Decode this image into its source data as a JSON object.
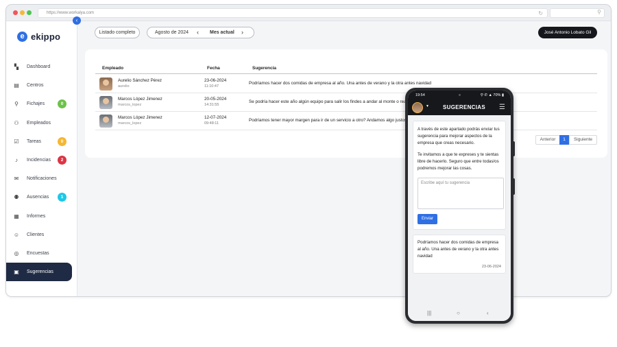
{
  "browser": {
    "url": "https://www.workalya.com"
  },
  "logo": {
    "text": "ekippo"
  },
  "sidebar": {
    "items": [
      {
        "label": "Dashboard",
        "icon": "dashboard-icon",
        "glyph": "▚"
      },
      {
        "label": "Centros",
        "icon": "building-icon",
        "glyph": "▤"
      },
      {
        "label": "Fichajes",
        "icon": "location-pin-icon",
        "glyph": "⚲",
        "badge": "0",
        "badge_color": "#6cc24a"
      },
      {
        "label": "Empleados",
        "icon": "users-icon",
        "glyph": "⚇"
      },
      {
        "label": "Tareas",
        "icon": "calendar-check-icon",
        "glyph": "☑",
        "badge": "0",
        "badge_color": "#f5b731"
      },
      {
        "label": "Incidencias",
        "icon": "bell-icon",
        "glyph": "♪",
        "badge": "2",
        "badge_color": "#dc3545"
      },
      {
        "label": "Notificaciones",
        "icon": "chat-icon",
        "glyph": "✉"
      },
      {
        "label": "Ausencias",
        "icon": "user-minus-icon",
        "glyph": "⚉",
        "badge": "1",
        "badge_color": "#1ec8e6"
      },
      {
        "label": "Informes",
        "icon": "document-icon",
        "glyph": "▦"
      },
      {
        "label": "Clientes",
        "icon": "user-icon",
        "glyph": "☺"
      },
      {
        "label": "Encuestas",
        "icon": "survey-icon",
        "glyph": "◎"
      },
      {
        "label": "Sugerencias",
        "icon": "inbox-icon",
        "glyph": "▣",
        "active": true
      }
    ]
  },
  "toolbar": {
    "listado": "Listado completo",
    "month": "Agosto de 2024",
    "current": "Mes actual",
    "user": "José Antonio Lobato Gil"
  },
  "table": {
    "headers": {
      "employee": "Empleado",
      "date": "Fecha",
      "suggestion": "Sugerencia"
    },
    "rows": [
      {
        "name": "Aurelio Sánchez Pérez",
        "user": "aurelio",
        "date": "23-06-2024",
        "time": "11:10:47",
        "text": "Podríamos hacer dos comidas de empresa al año. Una antes de verano y la otra antes navidad"
      },
      {
        "name": "Marcos López Jimenez",
        "user": "marcos_lopez",
        "date": "20-05-2024",
        "time": "14:31:55",
        "text": "Se podría hacer este año algún equipo para salir los findes a andar al monte o realizar alguna actividad"
      },
      {
        "name": "Marcos López Jimenez",
        "user": "marcos_lopez",
        "date": "12-07-2024",
        "time": "09:48:11",
        "text": "Podríamos tener mayor margen para ir de un servicio a otro? Andamos algo justos de tiempo"
      }
    ]
  },
  "pagination": {
    "prev": "Anterior",
    "page": "1",
    "next": "Siguiente"
  },
  "phone": {
    "status_time": "19:54",
    "status_sys": "⚲ ✆ ▲ 70% ▮",
    "title": "SUGERENCIAS",
    "intro1": "A través de este apartado podrás enviar tus sugerencia para mejorar aspectos de la empresa que creas necesario.",
    "intro2": "Te invitamos a que te expreses y te sientas libre de hacerlo. Seguro que entre todas/os podremos mejorar las cosas.",
    "placeholder": "Escribe aquí tu sugerencia",
    "send": "Enviar",
    "suggestion": "Podríamos hacer dos comidas de empresa al año. Una antes de verano y la otra antes navidad",
    "suggestion_date": "23-06-2024"
  }
}
